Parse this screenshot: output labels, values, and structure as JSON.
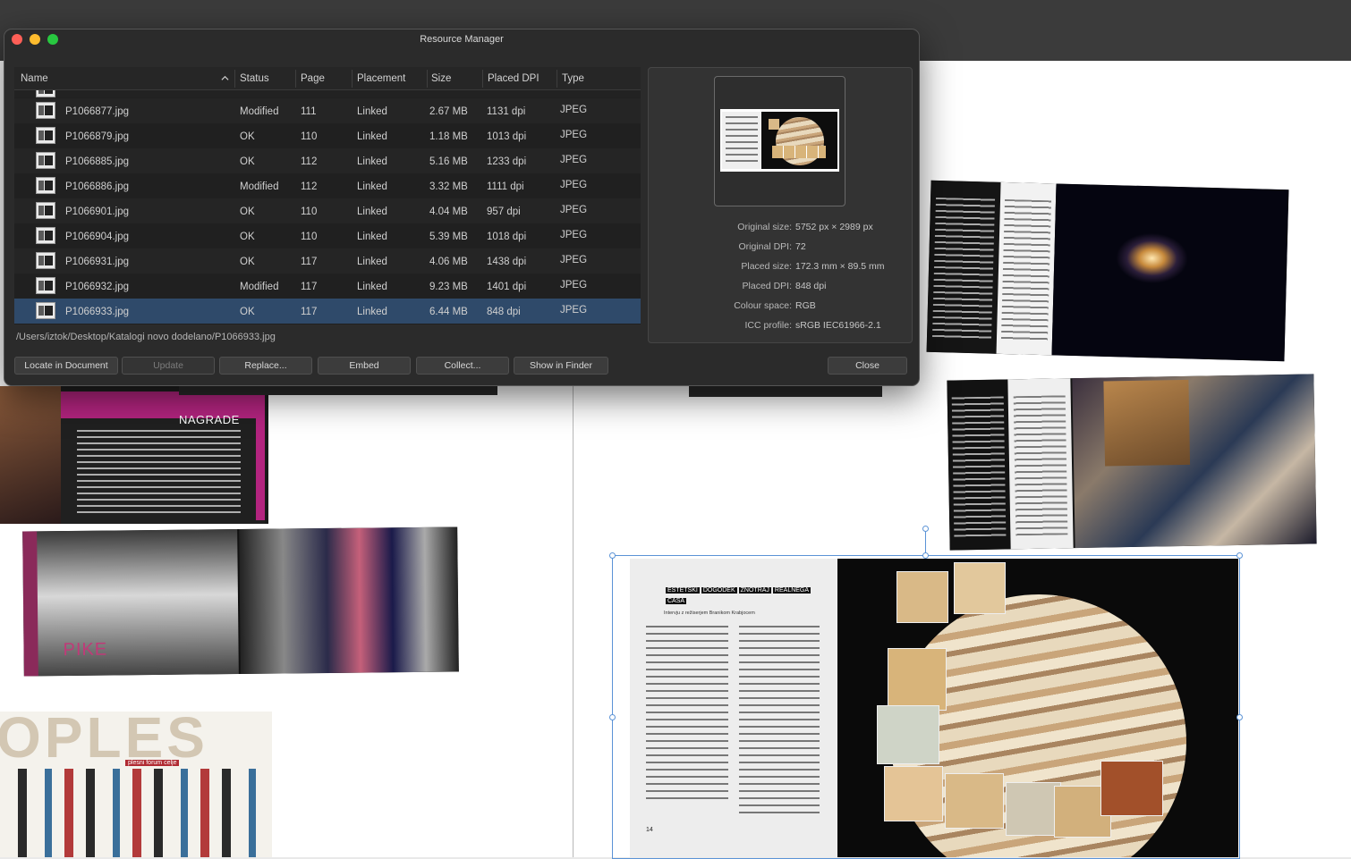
{
  "dialog": {
    "title": "Resource Manager",
    "columns": [
      "Name",
      "Status",
      "Page",
      "Placement",
      "Size",
      "Placed DPI",
      "Type"
    ],
    "rows": [
      {
        "name": "P1066877.jpg",
        "status": "Modified",
        "page": "111",
        "placement": "Linked",
        "size": "2.67 MB",
        "dpi": "1131 dpi",
        "type": "JPEG"
      },
      {
        "name": "P1066879.jpg",
        "status": "OK",
        "page": "110",
        "placement": "Linked",
        "size": "1.18 MB",
        "dpi": "1013 dpi",
        "type": "JPEG"
      },
      {
        "name": "P1066885.jpg",
        "status": "OK",
        "page": "112",
        "placement": "Linked",
        "size": "5.16 MB",
        "dpi": "1233 dpi",
        "type": "JPEG"
      },
      {
        "name": "P1066886.jpg",
        "status": "Modified",
        "page": "112",
        "placement": "Linked",
        "size": "3.32 MB",
        "dpi": "1111 dpi",
        "type": "JPEG"
      },
      {
        "name": "P1066901.jpg",
        "status": "OK",
        "page": "110",
        "placement": "Linked",
        "size": "4.04 MB",
        "dpi": "957 dpi",
        "type": "JPEG"
      },
      {
        "name": "P1066904.jpg",
        "status": "OK",
        "page": "110",
        "placement": "Linked",
        "size": "5.39 MB",
        "dpi": "1018 dpi",
        "type": "JPEG"
      },
      {
        "name": "P1066931.jpg",
        "status": "OK",
        "page": "117",
        "placement": "Linked",
        "size": "4.06 MB",
        "dpi": "1438 dpi",
        "type": "JPEG"
      },
      {
        "name": "P1066932.jpg",
        "status": "Modified",
        "page": "117",
        "placement": "Linked",
        "size": "9.23 MB",
        "dpi": "1401 dpi",
        "type": "JPEG"
      },
      {
        "name": "P1066933.jpg",
        "status": "OK",
        "page": "117",
        "placement": "Linked",
        "size": "6.44 MB",
        "dpi": "848 dpi",
        "type": "JPEG",
        "selected": true
      }
    ],
    "path": "/Users/iztok/Desktop/Katalogi novo dodelano/P1066933.jpg",
    "info": [
      {
        "label": "Original size:",
        "value": "5752 px × 2989 px"
      },
      {
        "label": "Original DPI:",
        "value": "72"
      },
      {
        "label": "Placed size:",
        "value": "172.3 mm × 89.5 mm"
      },
      {
        "label": "Placed DPI:",
        "value": "848 dpi"
      },
      {
        "label": "Colour space:",
        "value": "RGB"
      },
      {
        "label": "ICC profile:",
        "value": "sRGB IEC61966-2.1"
      }
    ],
    "buttons": {
      "locate": "Locate in Document",
      "update": "Update",
      "replace": "Replace...",
      "embed": "Embed",
      "collect": "Collect...",
      "show_in_finder": "Show in Finder",
      "close": "Close"
    }
  },
  "canvas": {
    "nagrade_title": "NAGRADE",
    "pike_title": "PIKE",
    "ples_title": "OPLES",
    "ples_subtitle": "plesni forum celje",
    "jupiter_labels": [
      "ESTETSKI",
      "DOGODEK",
      "ZNOTRAJ",
      "REALNEGA",
      "ČASA"
    ],
    "jupiter_subtitle": "Intervju z režiserjem Branikom Krabjocem",
    "jupiter_page_number": "14"
  },
  "colors": {
    "dialog_bg": "#2b2b2b",
    "selected_row": "#2f4a6a",
    "selection_handle": "#5b93d6",
    "traffic_red": "#fe5f57",
    "traffic_yellow": "#febc2e",
    "traffic_green": "#28c840"
  }
}
